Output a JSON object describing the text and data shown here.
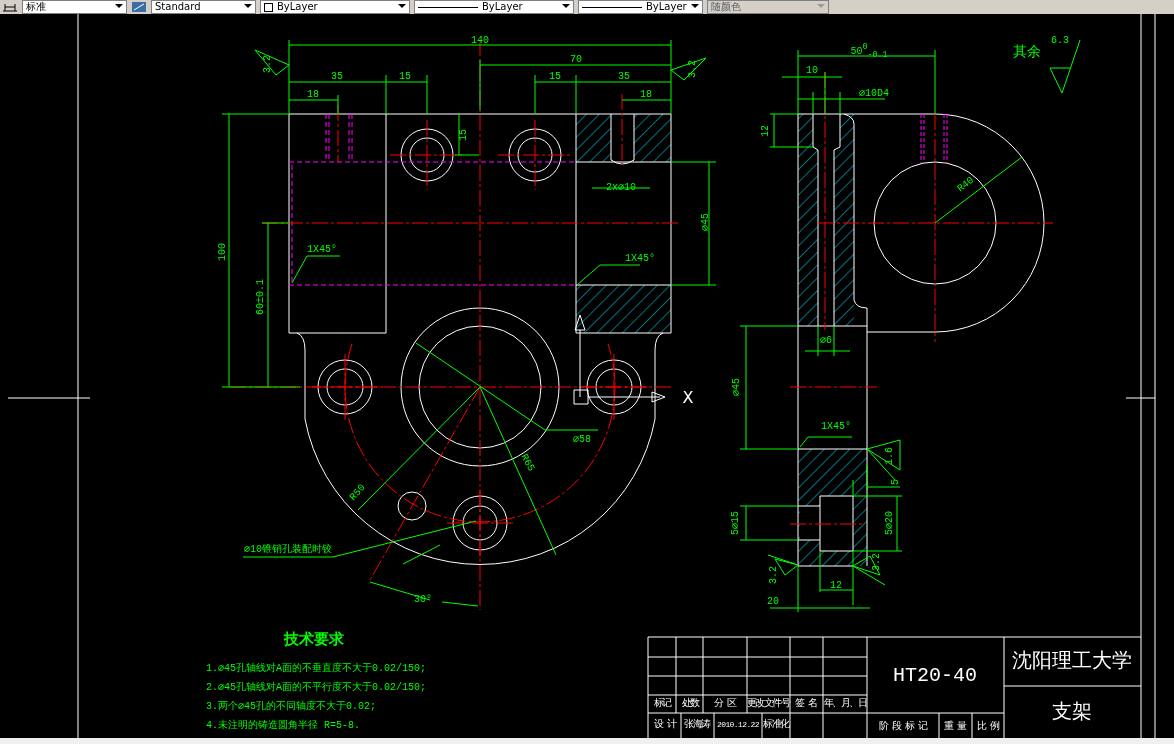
{
  "toolbar": {
    "controls": [
      {
        "kind": "textstyle",
        "value": "标准",
        "disabled": false
      },
      {
        "kind": "dimstyle",
        "value": "Standard",
        "disabled": false
      },
      {
        "kind": "layer-color",
        "value": "ByLayer",
        "disabled": false
      },
      {
        "kind": "linetype",
        "value": "ByLayer",
        "disabled": false
      },
      {
        "kind": "lineweight",
        "value": "ByLayer",
        "disabled": false
      },
      {
        "kind": "plotstyle",
        "value": "随颜色",
        "disabled": true
      }
    ]
  },
  "drawing": {
    "front_view_labels": [
      "140",
      "70",
      "35",
      "15",
      "15",
      "35",
      "18",
      "18",
      "15",
      "100",
      "60±0.1",
      "1X45°",
      "1X45°",
      "⌀45",
      "2x⌀10",
      "⌀58",
      "R65",
      "R50",
      "⌀10锥销孔装配时铰",
      "30°",
      "3.2",
      "3.2"
    ],
    "side_view_labels": [
      "50$^{0}$$_{-0.1}$",
      "10",
      "⌀10D4",
      "12",
      "R40",
      "⌀6",
      "⌀45",
      "1X45°",
      "1.6",
      "5",
      "5⌀20",
      "5⌀15",
      "3.2",
      "3.2",
      "12",
      "20"
    ],
    "surface_note": {
      "label": "其余",
      "roughness": "6.3"
    },
    "ucs_axis": "X"
  },
  "technical_requirements": {
    "title": "技术要求",
    "items": [
      "1.⌀45孔轴线对A面的不垂直度不大于0.02/150;",
      "2.⌀45孔轴线对A面的不平行度不大于0.02/150;",
      "3.两个⌀45孔的不同轴度不大于0.02;",
      "4.未注明的铸造圆角半径  R=5-8."
    ]
  },
  "title_block": {
    "revision_headers": [
      "标记",
      "处数",
      "分 区",
      "更改文件号",
      "签 名",
      "年、月、日"
    ],
    "design_row": [
      "设 计",
      "张海涛",
      "2010.12.22",
      "标准化"
    ],
    "material": "HT20-40",
    "stage_headers": [
      "阶 段 标 记",
      "重 量",
      "比 例"
    ],
    "school": "沈阳理工大学",
    "part_name": "支架"
  }
}
